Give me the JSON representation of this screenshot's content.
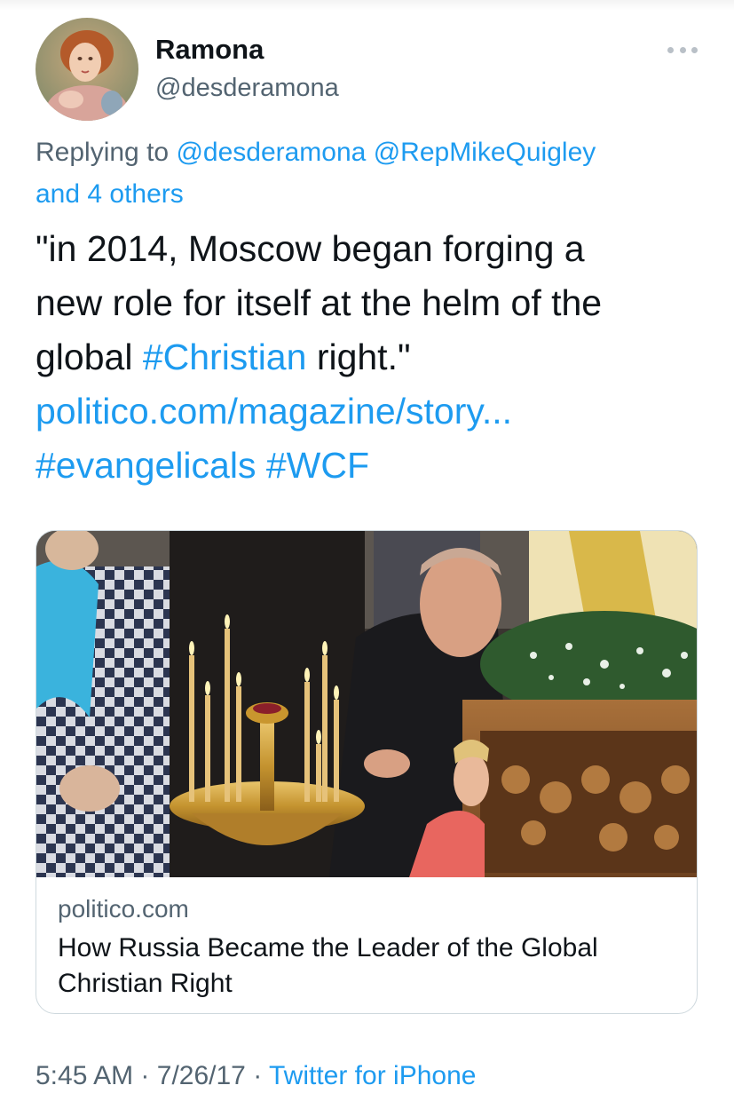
{
  "author": {
    "name": "Ramona",
    "handle": "@desderamona"
  },
  "reply_context": {
    "prefix": "Replying to",
    "mention_1": "@desderamona",
    "mention_2": "@RepMikeQuigley",
    "others": "and 4 others"
  },
  "tweet": {
    "line_1": "\"in 2014, Moscow began forging a",
    "line_2": "new role for itself at the helm of the",
    "line_3_pre": "global ",
    "hashtag_christian": "#Christian",
    "line_3_post": " right.\"",
    "link": "politico.com/magazine/story...",
    "hashtag_evangelicals": "#evangelicals",
    "hashtag_wcf": "#WCF"
  },
  "card": {
    "domain": "politico.com",
    "title": "How Russia Became the Leader of the Global Christian Right"
  },
  "meta": {
    "time": "5:45 AM",
    "separator": "·",
    "date": "7/26/17",
    "source": "Twitter for iPhone"
  },
  "icons": {
    "more": "ellipsis-icon",
    "avatar": "profile-photo"
  },
  "colors": {
    "accent": "#1d9bf0",
    "secondary_text": "#536471",
    "primary_text": "#0f1419",
    "border": "#cfd9de"
  }
}
